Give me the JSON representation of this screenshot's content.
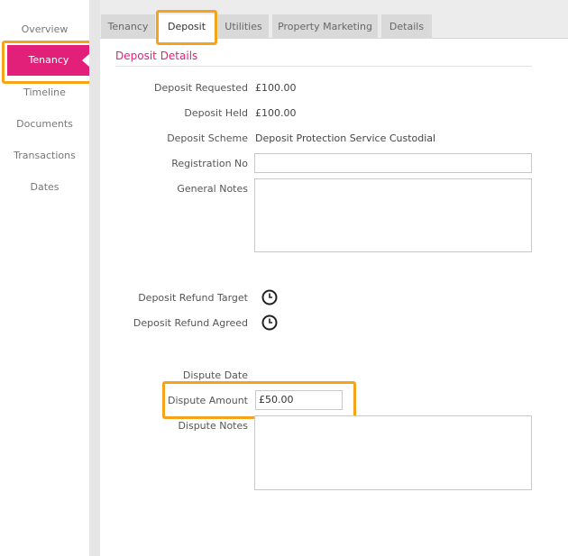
{
  "sidebar": {
    "items": [
      {
        "label": "Overview"
      },
      {
        "label": "Tenancy",
        "active": true
      },
      {
        "label": "Timeline"
      },
      {
        "label": "Documents"
      },
      {
        "label": "Transactions"
      },
      {
        "label": "Dates"
      }
    ]
  },
  "tabs": [
    {
      "label": "Tenancy"
    },
    {
      "label": "Deposit",
      "active": true
    },
    {
      "label": "Utilities"
    },
    {
      "label": "Property Marketing"
    },
    {
      "label": "Details"
    }
  ],
  "section": {
    "title": "Deposit Details"
  },
  "fields": {
    "deposit_requested": {
      "label": "Deposit Requested",
      "value": "£100.00"
    },
    "deposit_held": {
      "label": "Deposit Held",
      "value": "£100.00"
    },
    "deposit_scheme": {
      "label": "Deposit Scheme",
      "value": "Deposit Protection Service Custodial"
    },
    "registration_no": {
      "label": "Registration No",
      "value": ""
    },
    "general_notes": {
      "label": "General Notes",
      "value": ""
    },
    "deposit_refund_target": {
      "label": "Deposit Refund Target"
    },
    "deposit_refund_agreed": {
      "label": "Deposit Refund Agreed"
    },
    "dispute_date": {
      "label": "Dispute Date"
    },
    "dispute_amount": {
      "label": "Dispute Amount",
      "value": "£50.00"
    },
    "dispute_notes": {
      "label": "Dispute Notes",
      "value": ""
    }
  },
  "colors": {
    "accent": "#e2207a",
    "highlight": "#f4a31a"
  },
  "icons": {
    "date_picker": "clock-icon"
  }
}
